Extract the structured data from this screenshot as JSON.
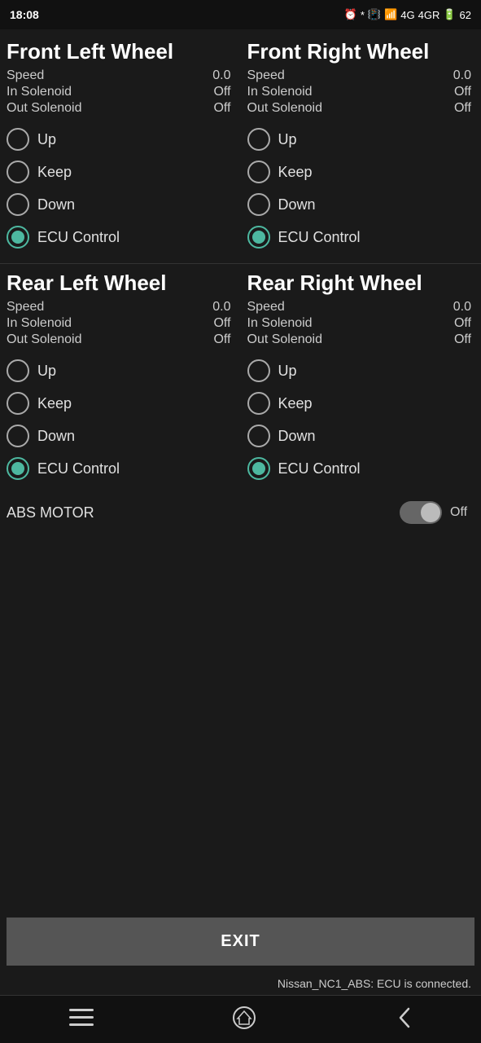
{
  "statusBar": {
    "time": "18:08",
    "battery": "62"
  },
  "wheels": {
    "frontLeft": {
      "title": "Front Left Wheel",
      "speed": {
        "label": "Speed",
        "value": "0.0"
      },
      "inSolenoid": {
        "label": "In Solenoid",
        "value": "Off"
      },
      "outSolenoid": {
        "label": "Out Solenoid",
        "value": "Off"
      },
      "options": [
        {
          "label": "Up",
          "selected": false
        },
        {
          "label": "Keep",
          "selected": false
        },
        {
          "label": "Down",
          "selected": false
        },
        {
          "label": "ECU Control",
          "selected": true
        }
      ]
    },
    "frontRight": {
      "title": "Front Right Wheel",
      "speed": {
        "label": "Speed",
        "value": "0.0"
      },
      "inSolenoid": {
        "label": "In Solenoid",
        "value": "Off"
      },
      "outSolenoid": {
        "label": "Out Solenoid",
        "value": "Off"
      },
      "options": [
        {
          "label": "Up",
          "selected": false
        },
        {
          "label": "Keep",
          "selected": false
        },
        {
          "label": "Down",
          "selected": false
        },
        {
          "label": "ECU Control",
          "selected": true
        }
      ]
    },
    "rearLeft": {
      "title": "Rear Left Wheel",
      "speed": {
        "label": "Speed",
        "value": "0.0"
      },
      "inSolenoid": {
        "label": "In Solenoid",
        "value": "Off"
      },
      "outSolenoid": {
        "label": "Out Solenoid",
        "value": "Off"
      },
      "options": [
        {
          "label": "Up",
          "selected": false
        },
        {
          "label": "Keep",
          "selected": false
        },
        {
          "label": "Down",
          "selected": false
        },
        {
          "label": "ECU Control",
          "selected": true
        }
      ]
    },
    "rearRight": {
      "title": "Rear Right Wheel",
      "speed": {
        "label": "Speed",
        "value": "0.0"
      },
      "inSolenoid": {
        "label": "In Solenoid",
        "value": "Off"
      },
      "outSolenoid": {
        "label": "Out Solenoid",
        "value": "Off"
      },
      "options": [
        {
          "label": "Up",
          "selected": false
        },
        {
          "label": "Keep",
          "selected": false
        },
        {
          "label": "Down",
          "selected": false
        },
        {
          "label": "ECU Control",
          "selected": true
        }
      ]
    }
  },
  "absMotor": {
    "label": "ABS MOTOR",
    "status": "Off",
    "enabled": false
  },
  "exitButton": {
    "label": "EXIT"
  },
  "connectionStatus": "Nissan_NC1_ABS: ECU is connected.",
  "nav": {
    "menu": "☰",
    "home": "⌂",
    "back": "‹"
  }
}
